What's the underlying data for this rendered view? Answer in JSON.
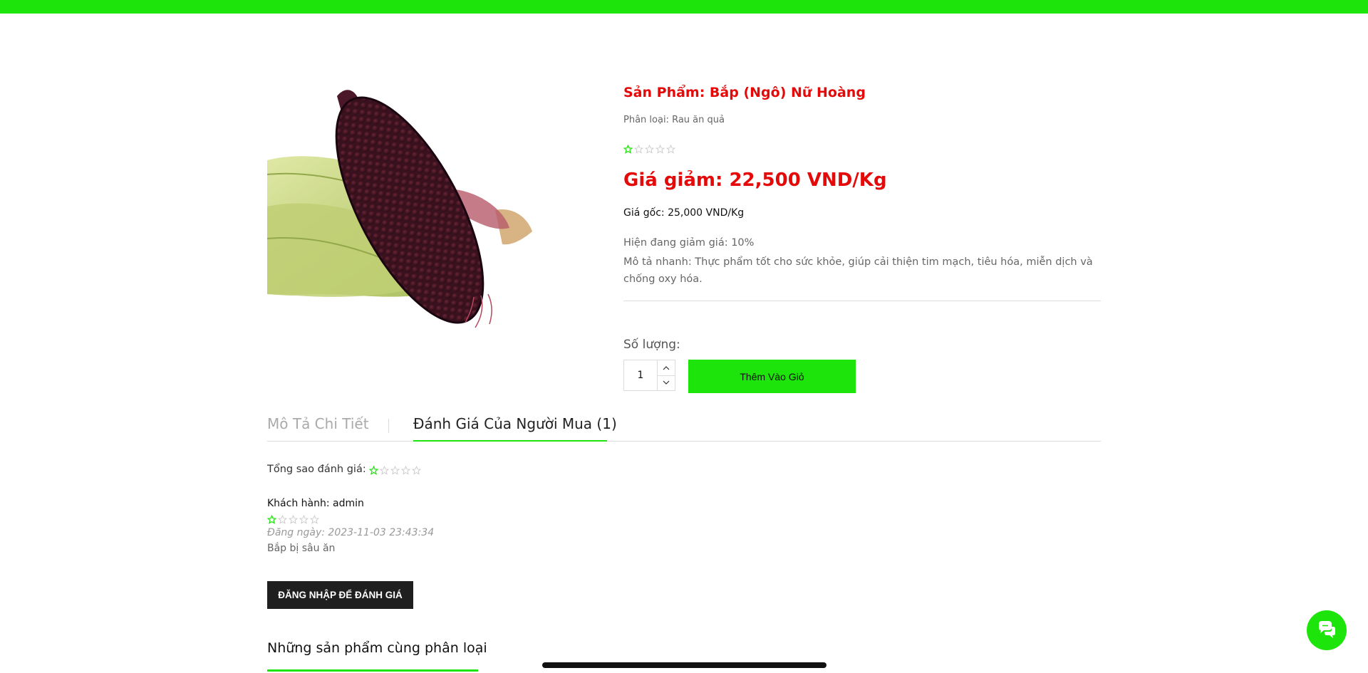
{
  "colors": {
    "accent": "#1de40a",
    "price_red": "#e40a0a",
    "dark_button": "#1f1f1f"
  },
  "product": {
    "title": "Sản Phẩm: Bắp (Ngô) Nữ Hoàng",
    "category": "Phân loại: Rau ăn quả",
    "rating": 1,
    "rating_max": 5,
    "sale_price": "Giá giảm: 22,500 VND/Kg",
    "original_price": "Giá gốc: 25,000 VND/Kg",
    "discount": "Hiện đang giảm giá: 10%",
    "short_description": "Mô tả nhanh: Thực phẩm tốt cho sức khỏe, giúp cải thiện tim mạch, tiêu hóa, miễn dịch và chống oxy hóa.",
    "image_icon": "purple-corn-image"
  },
  "quantity": {
    "label": "Số lượng:",
    "value": "1",
    "up_icon": "chevron-up-icon",
    "down_icon": "chevron-down-icon"
  },
  "cart": {
    "add_label": "Thêm Vào Giỏ"
  },
  "tabs": [
    {
      "label": "Mô Tả Chi Tiết",
      "active": false
    },
    {
      "label": "Đánh Giá Của Người Mua (1)",
      "active": true
    }
  ],
  "reviews": {
    "total_label": "Tổng sao đánh giá:",
    "total_rating": 1,
    "items": [
      {
        "customer": "Khách hành: admin",
        "rating": 1,
        "date": "Đăng ngày: 2023-11-03 23:43:34",
        "text": "Bắp bị sâu ăn"
      }
    ],
    "login_label": "ĐĂNG NHẬP ĐỂ ĐÁNH GIÁ"
  },
  "related": {
    "title": "Những sản phẩm cùng phân loại"
  },
  "chat": {
    "icon": "chat-bubbles-icon"
  }
}
